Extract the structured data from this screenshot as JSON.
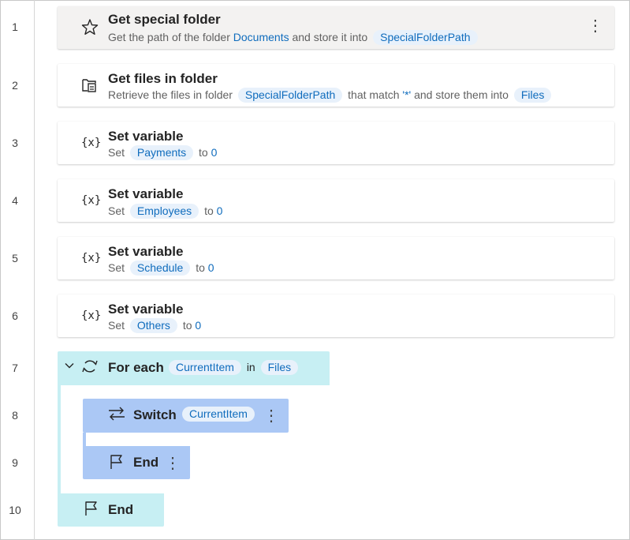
{
  "lines": [
    "1",
    "2",
    "3",
    "4",
    "5",
    "6",
    "7",
    "8",
    "9",
    "10"
  ],
  "steps": [
    {
      "title": "Get special folder",
      "desc_prefix": "Get the path of the folder",
      "desc_link": "Documents",
      "desc_mid": "and store it into",
      "desc_var": "SpecialFolderPath",
      "icon": "star-icon",
      "more": "⋮"
    },
    {
      "title": "Get files in folder",
      "desc_prefix": "Retrieve the files in folder",
      "desc_var1": "SpecialFolderPath",
      "desc_mid1": "that match",
      "desc_pattern": "'*'",
      "desc_mid2": "and store them into",
      "desc_var2": "Files",
      "icon": "folder-files-icon"
    },
    {
      "title": "Set variable",
      "set_label": "Set",
      "var": "Payments",
      "to_label": "to",
      "value": "0",
      "icon_text": "{x}"
    },
    {
      "title": "Set variable",
      "set_label": "Set",
      "var": "Employees",
      "to_label": "to",
      "value": "0",
      "icon_text": "{x}"
    },
    {
      "title": "Set variable",
      "set_label": "Set",
      "var": "Schedule",
      "to_label": "to",
      "value": "0",
      "icon_text": "{x}"
    },
    {
      "title": "Set variable",
      "set_label": "Set",
      "var": "Others",
      "to_label": "to",
      "value": "0",
      "icon_text": "{x}"
    }
  ],
  "foreach": {
    "title": "For each",
    "var": "CurrentItem",
    "in_label": "in",
    "collection": "Files"
  },
  "switch": {
    "title": "Switch",
    "var": "CurrentItem",
    "more": "⋮"
  },
  "end_inner": {
    "title": "End",
    "more": "⋮"
  },
  "end_outer": {
    "title": "End"
  },
  "colors": {
    "accent": "#0f6cbd",
    "loop_block": "#c7eff3",
    "switch_block": "#abc8f5",
    "pill": "#e8f1fb"
  }
}
